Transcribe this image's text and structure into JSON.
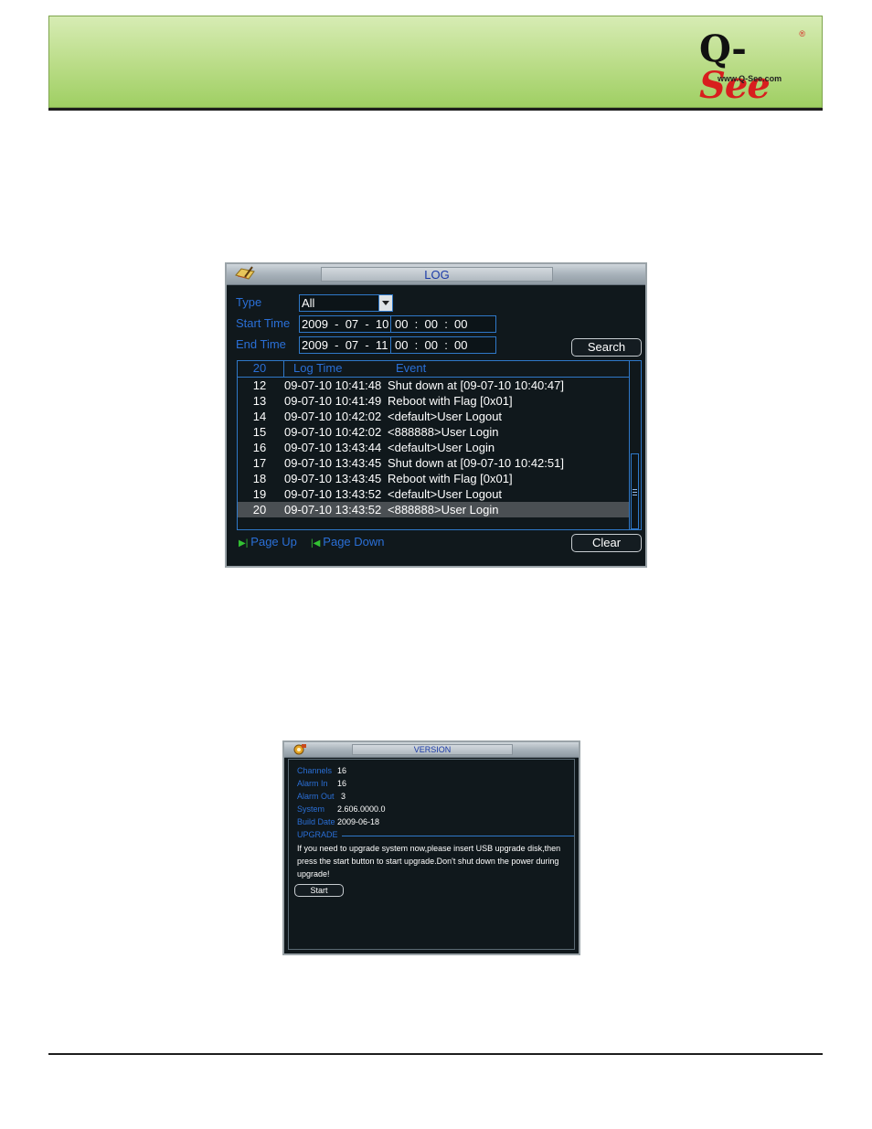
{
  "header": {
    "logo_q": "Q-",
    "logo_see": "See",
    "logo_reg": "®",
    "logo_url": "www.Q-See.com"
  },
  "log_window": {
    "title": "LOG",
    "type_label": "Type",
    "type_value": "All",
    "start_label": "Start Time",
    "start_date": "2009  -  07  -  10",
    "start_time": "00  :  00  :  00",
    "end_label": "End Time",
    "end_date": "2009  -  07  -  11",
    "end_time": "00  :  00  :  00",
    "search_button": "Search",
    "columns": {
      "index": "20",
      "time": "Log Time",
      "event": "Event"
    },
    "rows": [
      {
        "index": "12",
        "time": "09-07-10 10:41:48",
        "event": "Shut down at [09-07-10 10:40:47]"
      },
      {
        "index": "13",
        "time": "09-07-10 10:41:49",
        "event": "Reboot with Flag [0x01]"
      },
      {
        "index": "14",
        "time": "09-07-10 10:42:02",
        "event": "<default>User Logout"
      },
      {
        "index": "15",
        "time": "09-07-10 10:42:02",
        "event": "<888888>User Login"
      },
      {
        "index": "16",
        "time": "09-07-10 13:43:44",
        "event": "<default>User Login"
      },
      {
        "index": "17",
        "time": "09-07-10 13:43:45",
        "event": "Shut down at [09-07-10 10:42:51]"
      },
      {
        "index": "18",
        "time": "09-07-10 13:43:45",
        "event": "Reboot with Flag [0x01]"
      },
      {
        "index": "19",
        "time": "09-07-10 13:43:52",
        "event": "<default>User Logout"
      },
      {
        "index": "20",
        "time": "09-07-10 13:43:52",
        "event": "<888888>User Login"
      }
    ],
    "selected_row": "20",
    "page_up": "Page Up",
    "page_down": "Page Down",
    "clear_button": "Clear"
  },
  "version_window": {
    "title": "VERSION",
    "channels_label": "Channels",
    "channels_value": "16",
    "alarm_in_label": "Alarm In",
    "alarm_in_value": "16",
    "alarm_out_label": "Alarm Out",
    "alarm_out_value": "3",
    "system_label": "System",
    "system_value": "2.606.0000.0",
    "build_label": "Build Date",
    "build_value": "2009-06-18",
    "upgrade_heading": "UPGRADE",
    "upgrade_note": "If you need to upgrade system now,please insert USB upgrade disk,then press the start button to start upgrade.Don't shut down the power during upgrade!",
    "start_button": "Start"
  },
  "colors": {
    "banner_green": "#b9dc86",
    "dvr_background": "#10181c",
    "label_blue": "#2a6fd6",
    "title_blue": "#1a3aa8"
  }
}
